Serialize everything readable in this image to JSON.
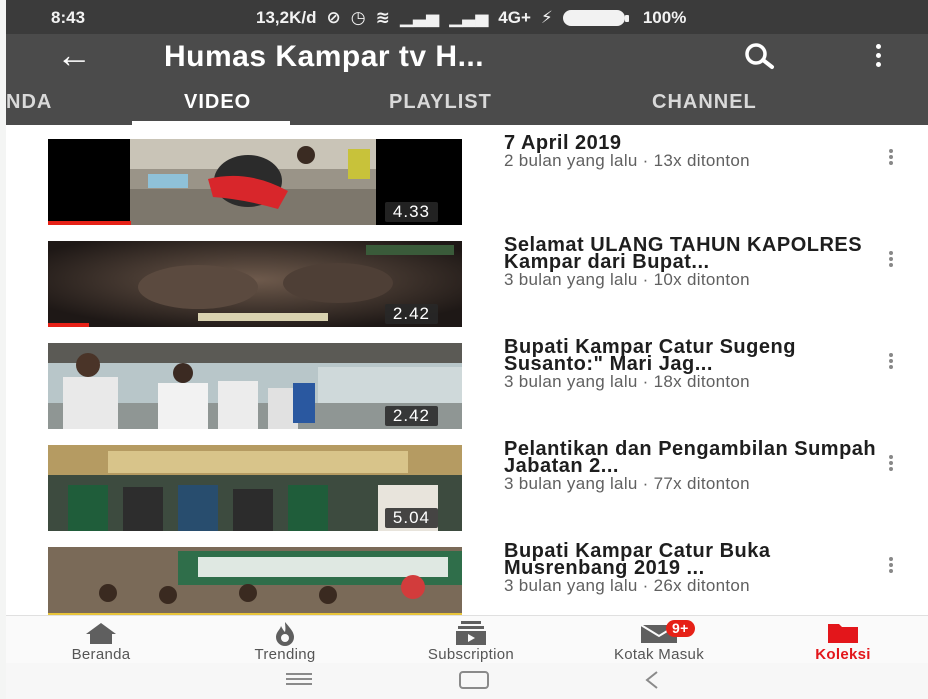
{
  "status": {
    "time": "8:43",
    "speed": "13,2K/d",
    "network": "4G+",
    "battery": "100%"
  },
  "appbar": {
    "title": "Humas Kampar tv H..."
  },
  "tabs": [
    {
      "label": "NDA"
    },
    {
      "label": "VIDEO"
    },
    {
      "label": "PLAYLIST"
    },
    {
      "label": "CHANNEL"
    }
  ],
  "videos": [
    {
      "title": "7 April 2019",
      "meta": "2 bulan yang lalu · 13x ditonton",
      "duration": "4.33",
      "watched_fraction": 0.2
    },
    {
      "title": "Selamat ULANG TAHUN KAPOLRES Kampar dari Bupat...",
      "meta": "3 bulan yang lalu · 10x ditonton",
      "duration": "2.42",
      "watched_fraction": 0.1
    },
    {
      "title": "Bupati Kampar Catur Sugeng Susanto:\" Mari Jag...",
      "meta": "3 bulan yang lalu · 18x ditonton",
      "duration": "2.42",
      "watched_fraction": 0
    },
    {
      "title": "Pelantikan dan Pengambilan Sumpah Jabatan 2...",
      "meta": "3 bulan yang lalu · 77x ditonton",
      "duration": "5.04",
      "watched_fraction": 0
    },
    {
      "title": "Bupati Kampar Catur Buka Musrenbang 2019 ...",
      "meta": "3 bulan yang lalu · 26x ditonton",
      "duration": "",
      "watched_fraction": 0
    }
  ],
  "bottom_nav": [
    {
      "label": "Beranda",
      "icon": "home-icon"
    },
    {
      "label": "Trending",
      "icon": "flame-icon"
    },
    {
      "label": "Subscription",
      "icon": "subscriptions-icon"
    },
    {
      "label": "Kotak Masuk",
      "icon": "inbox-icon",
      "badge": "9+"
    },
    {
      "label": "Koleksi",
      "icon": "folder-icon"
    }
  ],
  "colors": {
    "accent": "#e62117",
    "appbar": "#4b4b4b"
  }
}
